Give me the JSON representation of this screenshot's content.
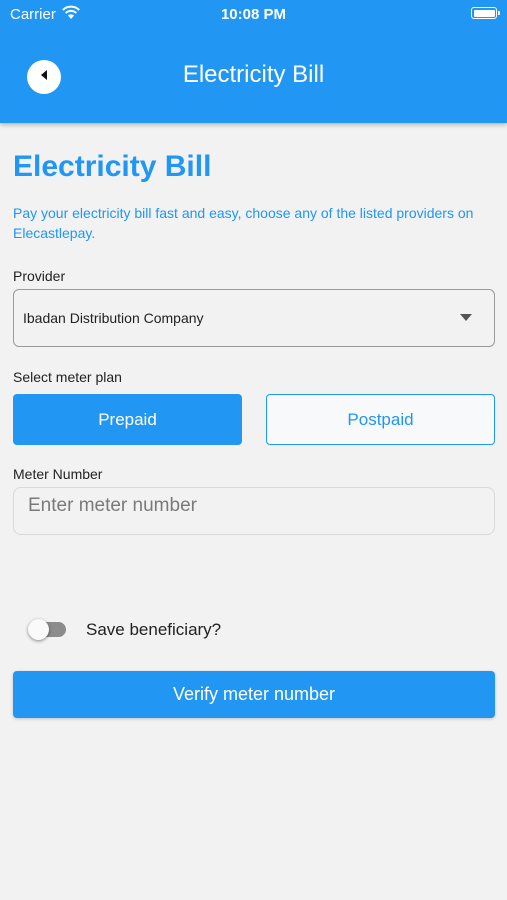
{
  "status_bar": {
    "carrier": "Carrier",
    "time": "10:08 PM"
  },
  "header": {
    "title": "Electricity Bill",
    "back_icon": "back-arrow-icon"
  },
  "main": {
    "title": "Electricity Bill",
    "subtitle": "Pay your electricity bill fast and easy, choose any of the listed providers on Elecastlepay."
  },
  "provider": {
    "label": "Provider",
    "selected": "Ibadan Distribution Company"
  },
  "meter_plan": {
    "label": "Select meter plan",
    "options": [
      "Prepaid",
      "Postpaid"
    ],
    "selected": "Prepaid"
  },
  "meter_number": {
    "label": "Meter Number",
    "placeholder": "Enter meter number",
    "value": ""
  },
  "save_beneficiary": {
    "label": "Save beneficiary?",
    "checked": false
  },
  "verify_button": {
    "label": "Verify meter number"
  },
  "colors": {
    "accent": "#2196f3",
    "background": "#f2f2f2"
  }
}
